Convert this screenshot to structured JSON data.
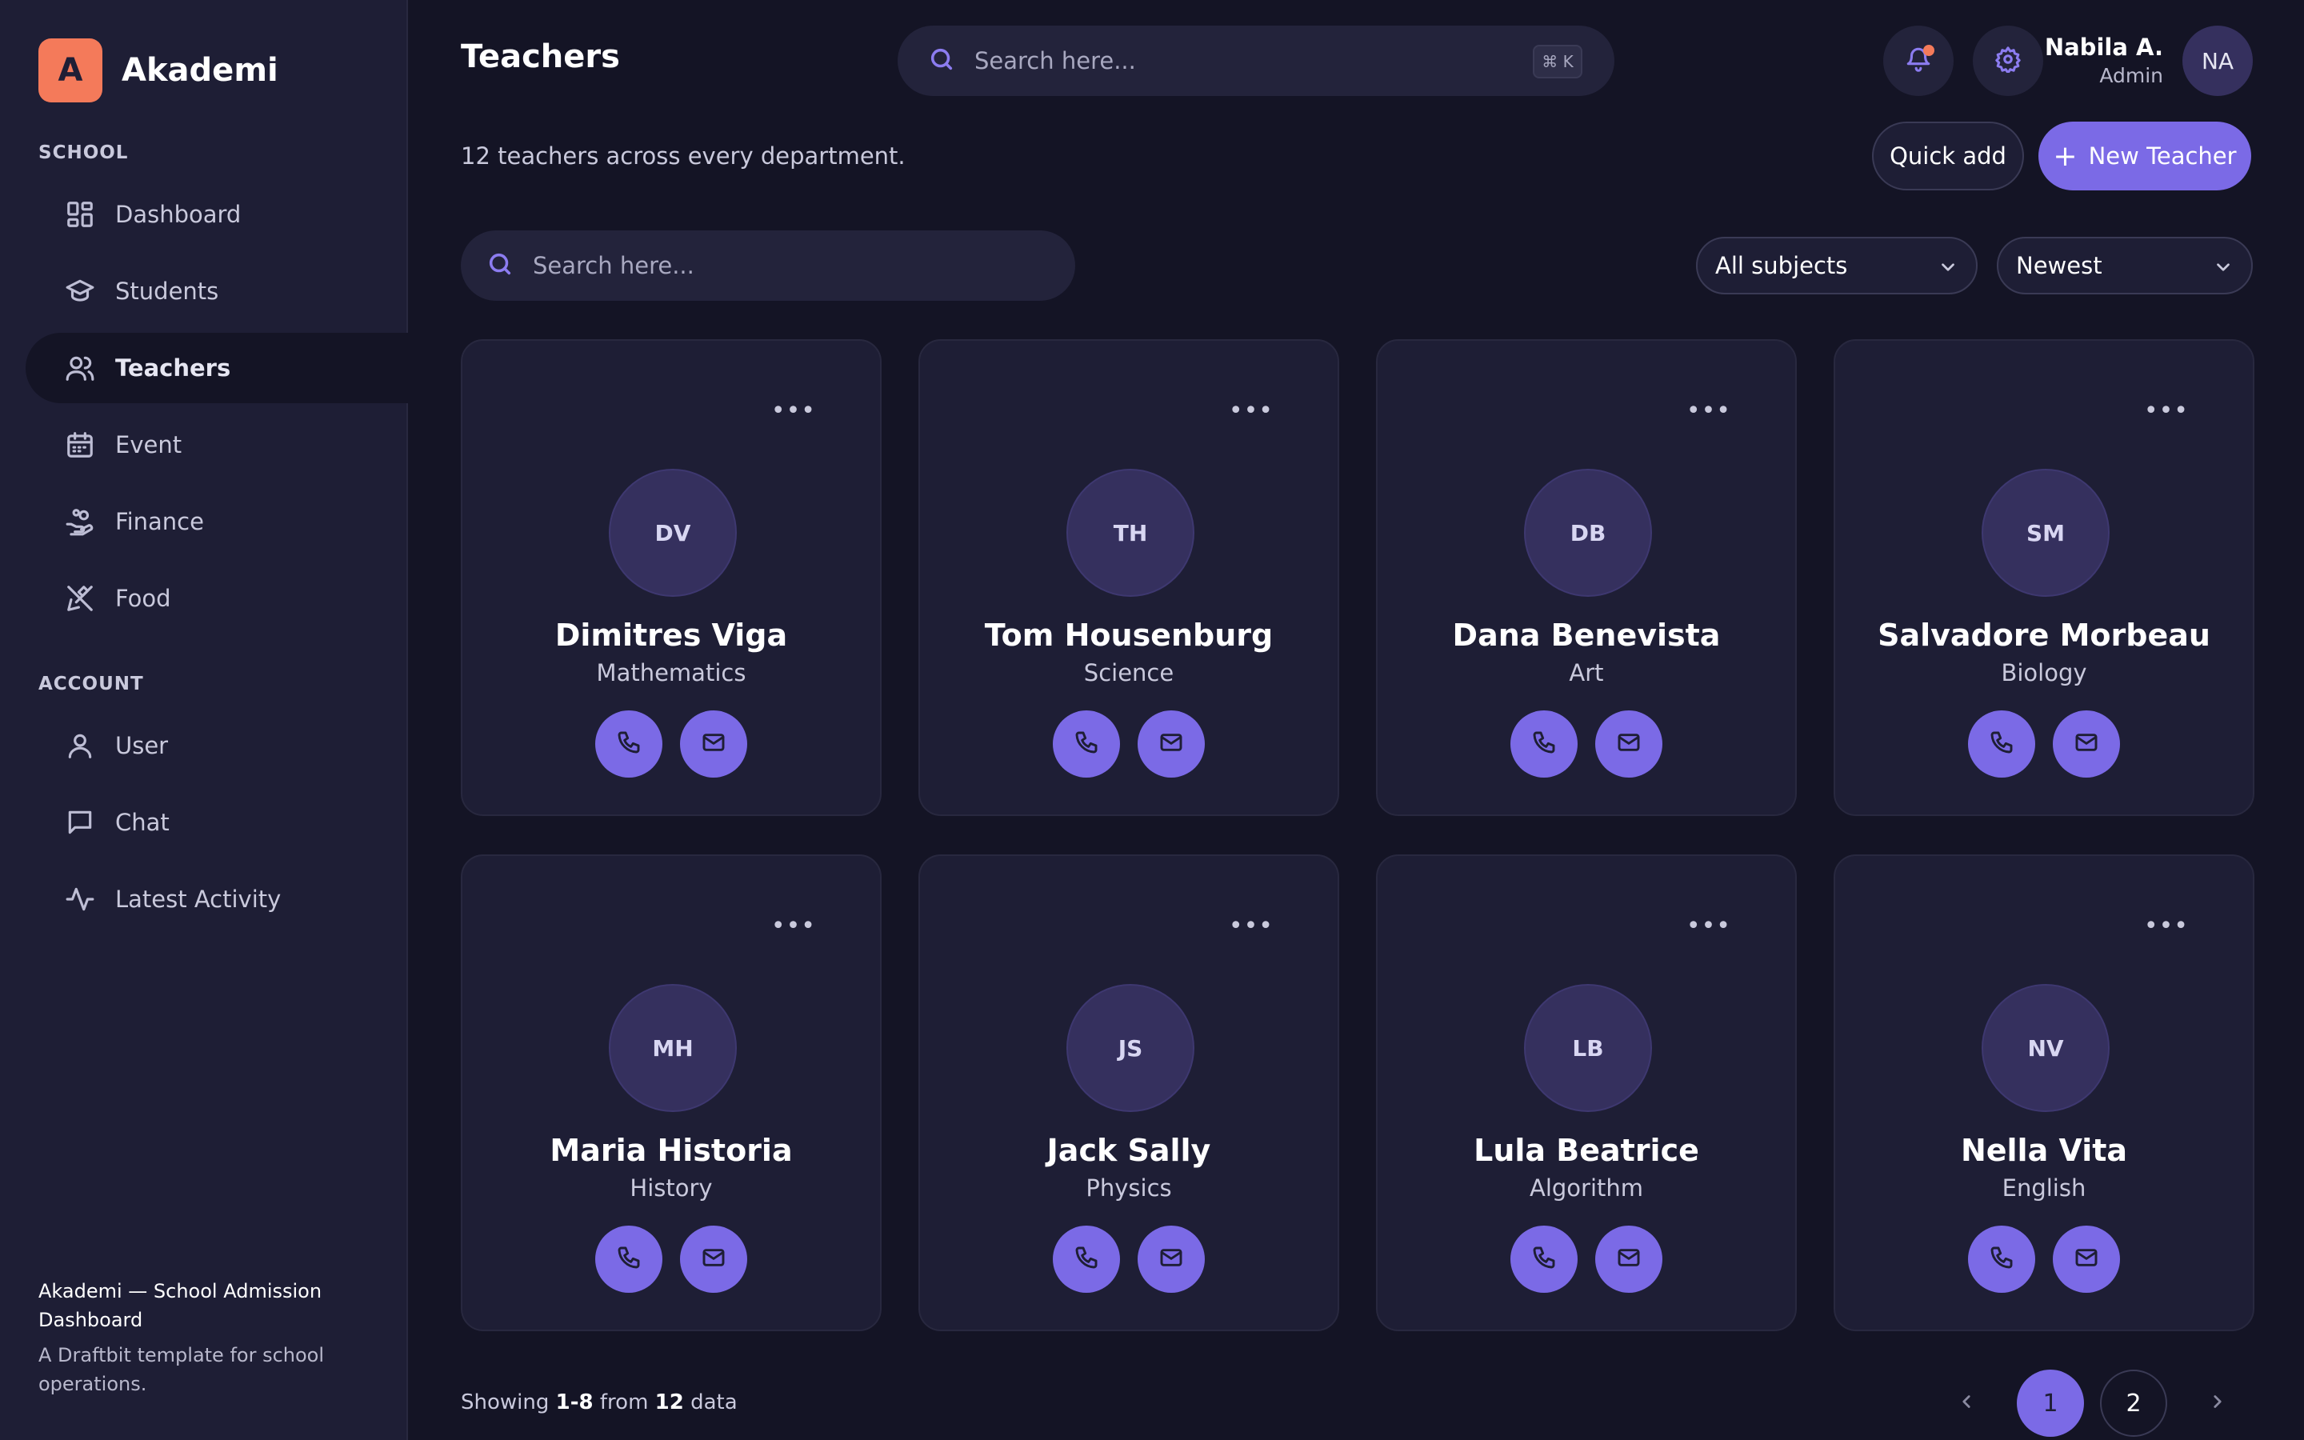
{
  "brand": {
    "logo_letter": "A",
    "name": "Akademi"
  },
  "sidebar": {
    "school_label": "SCHOOL",
    "school_items": [
      {
        "label": "Dashboard",
        "icon": "dashboard-icon",
        "active": false
      },
      {
        "label": "Students",
        "icon": "graduation-cap-icon",
        "active": false
      },
      {
        "label": "Teachers",
        "icon": "users-icon",
        "active": true
      },
      {
        "label": "Event",
        "icon": "calendar-icon",
        "active": false
      },
      {
        "label": "Finance",
        "icon": "hand-coins-icon",
        "active": false
      },
      {
        "label": "Food",
        "icon": "utensils-icon",
        "active": false
      }
    ],
    "account_label": "ACCOUNT",
    "account_items": [
      {
        "label": "User",
        "icon": "user-icon",
        "active": false
      },
      {
        "label": "Chat",
        "icon": "chat-icon",
        "active": false
      },
      {
        "label": "Latest Activity",
        "icon": "activity-icon",
        "active": false
      }
    ],
    "footer_title": "Akademi — School Admission Dashboard",
    "footer_subtitle": "A Draftbit template for school operations."
  },
  "header": {
    "title": "Teachers",
    "search_placeholder": "Search here...",
    "shortcut": "⌘ K",
    "user_name": "Nabila A.",
    "user_role": "Admin",
    "user_initials": "NA"
  },
  "toolbar": {
    "subtitle": "12 teachers across every department.",
    "quick_add_label": "Quick add",
    "new_teacher_label": "New Teacher",
    "search_placeholder": "Search here...",
    "subject_filter": "All subjects",
    "sort_filter": "Newest"
  },
  "teachers": [
    {
      "initials": "DV",
      "name": "Dimitres Viga",
      "subject": "Mathematics"
    },
    {
      "initials": "TH",
      "name": "Tom Housenburg",
      "subject": "Science"
    },
    {
      "initials": "DB",
      "name": "Dana Benevista",
      "subject": "Art"
    },
    {
      "initials": "SM",
      "name": "Salvadore Morbeau",
      "subject": "Biology"
    },
    {
      "initials": "MH",
      "name": "Maria Historia",
      "subject": "History"
    },
    {
      "initials": "JS",
      "name": "Jack Sally",
      "subject": "Physics"
    },
    {
      "initials": "LB",
      "name": "Lula Beatrice",
      "subject": "Algorithm"
    },
    {
      "initials": "NV",
      "name": "Nella Vita",
      "subject": "English"
    }
  ],
  "pagination": {
    "showing_prefix": "Showing",
    "range": "1-8",
    "from_word": "from",
    "total": "12",
    "suffix": "data",
    "pages": [
      "1",
      "2"
    ],
    "current_page": "1"
  },
  "colors": {
    "accent": "#7b6ae6",
    "brand": "#f47a5a",
    "background": "#141425",
    "surface": "#1e1e35"
  }
}
